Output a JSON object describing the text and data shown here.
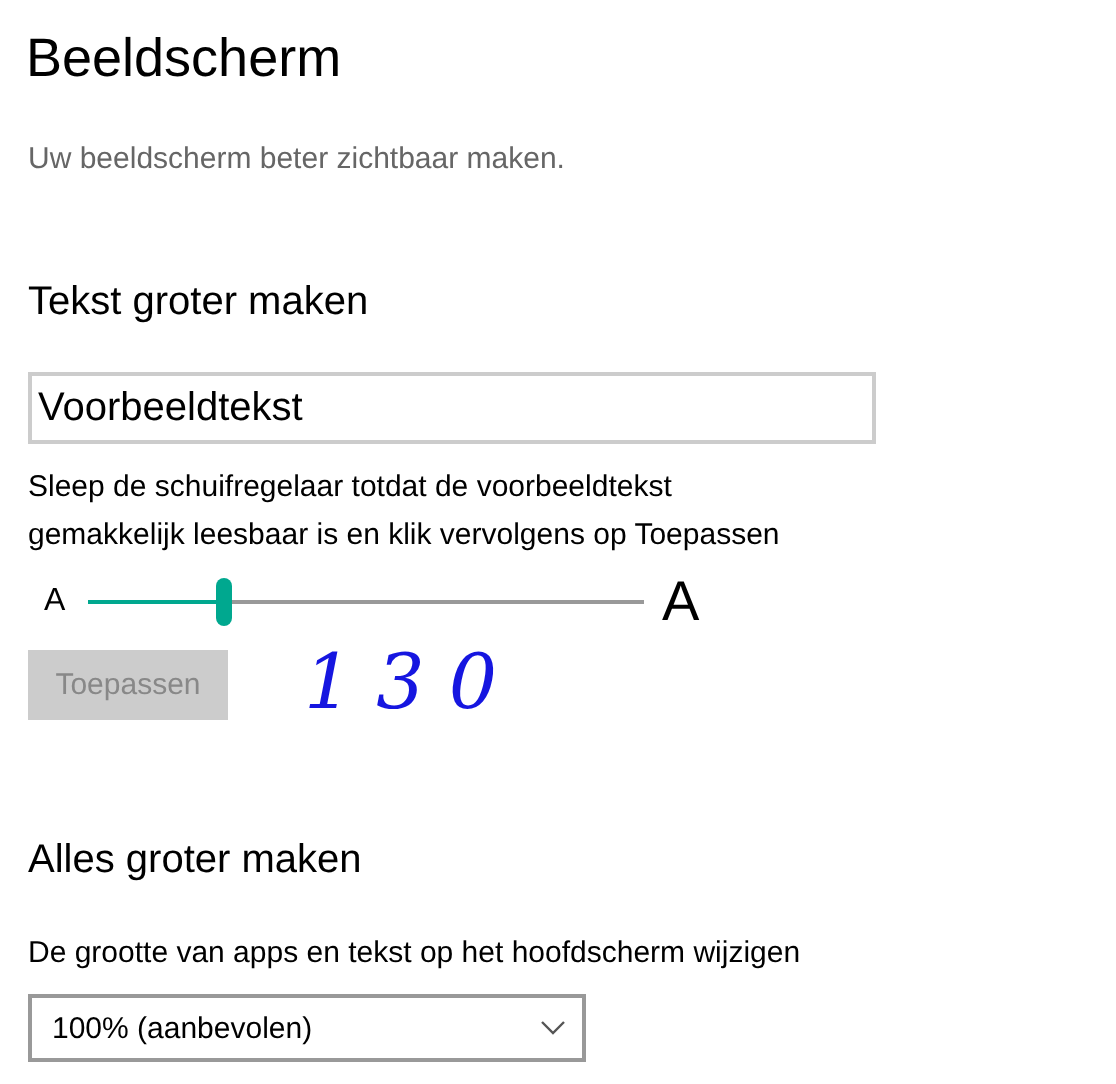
{
  "page": {
    "title": "Beeldscherm",
    "subtitle": "Uw beeldscherm beter zichtbaar maken."
  },
  "text_size": {
    "heading": "Tekst groter maken",
    "preview": {
      "value": "Voorbeeldtekst"
    },
    "instructions": "Sleep de schuifregelaar totdat de voorbeeldtekst gemakkelijk leesbaar is en klik vervolgens op Toepassen",
    "slider": {
      "min_label": "A",
      "max_label": "A",
      "level": 0.245
    },
    "apply_button": {
      "label": "Toepassen",
      "disabled": true
    },
    "annotation": "130"
  },
  "scale": {
    "heading": "Alles groter maken",
    "label": "De grootte van apps en tekst op het hoofdscherm wijzigen",
    "dropdown": {
      "value": "100% (aanbevolen)"
    }
  }
}
